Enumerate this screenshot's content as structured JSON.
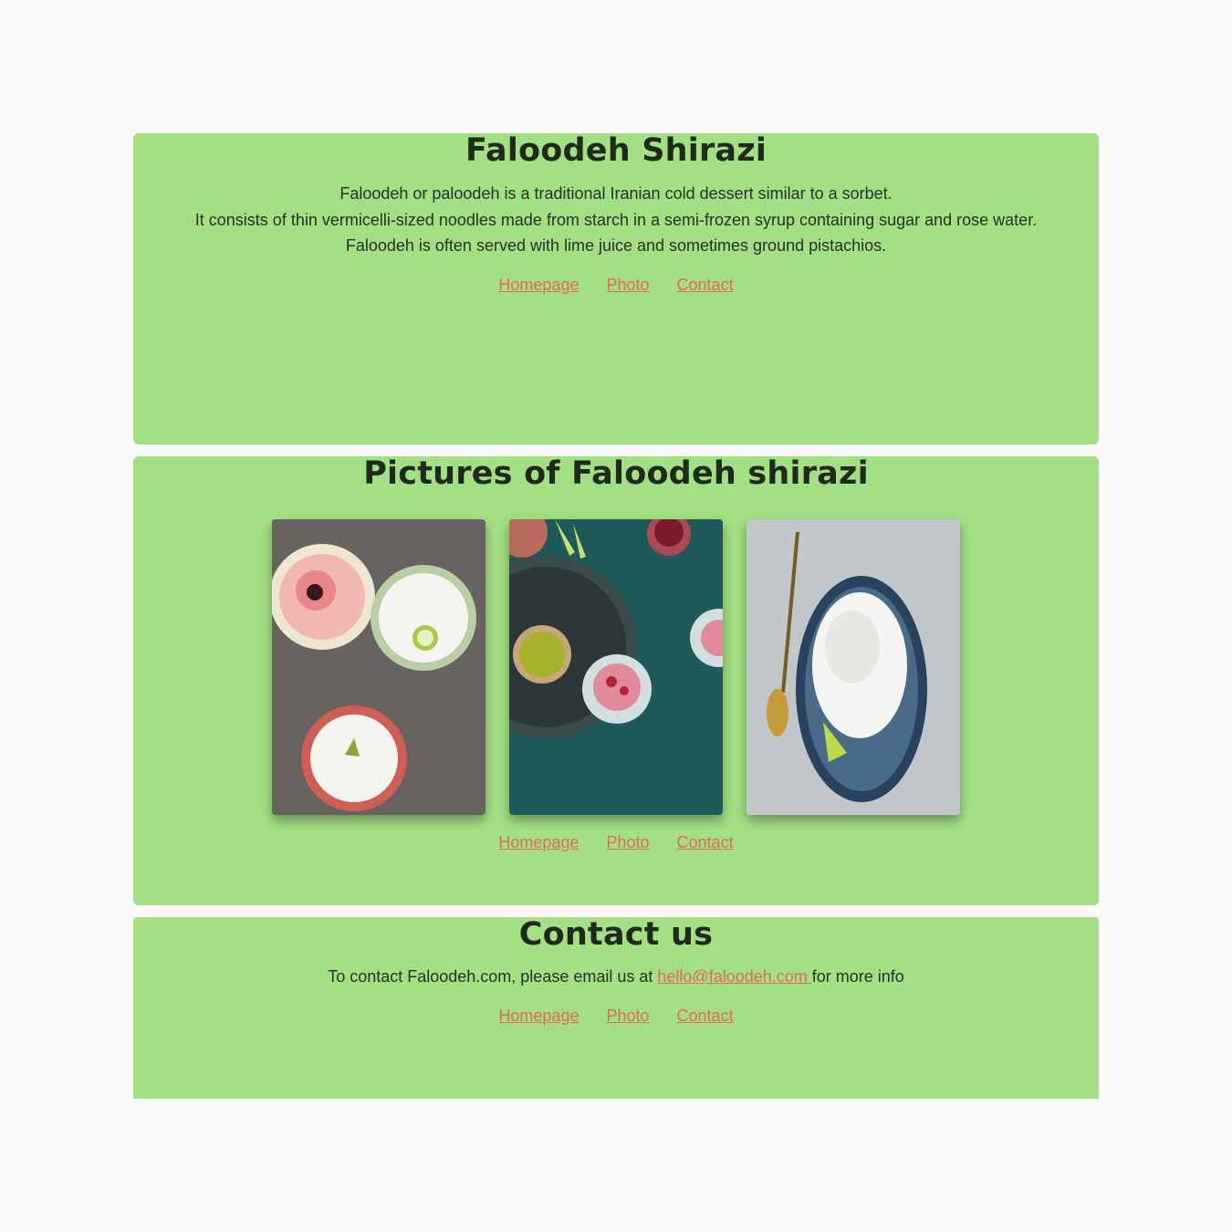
{
  "home": {
    "title": "Faloodeh Shirazi",
    "lines": [
      "Faloodeh or paloodeh is a traditional Iranian cold dessert similar to a sorbet.",
      "It consists of thin vermicelli-sized noodles made from starch in a semi-frozen syrup containing sugar and rose water.",
      "Faloodeh is often served with lime juice and sometimes ground pistachios."
    ]
  },
  "photos": {
    "title": "Pictures of Faloodeh shirazi"
  },
  "contact": {
    "title": "Contact us",
    "text_before": "To contact Faloodeh.com, please email us at ",
    "email": "hello@faloodeh.com ",
    "text_after": "for more info"
  },
  "nav": {
    "homepage": "Homepage",
    "photo": "Photo",
    "contact": "Contact"
  },
  "colors": {
    "page_background": "#faf8f8",
    "section_background": "#a3df83",
    "link": "#e26a5c",
    "text": "#222222"
  }
}
